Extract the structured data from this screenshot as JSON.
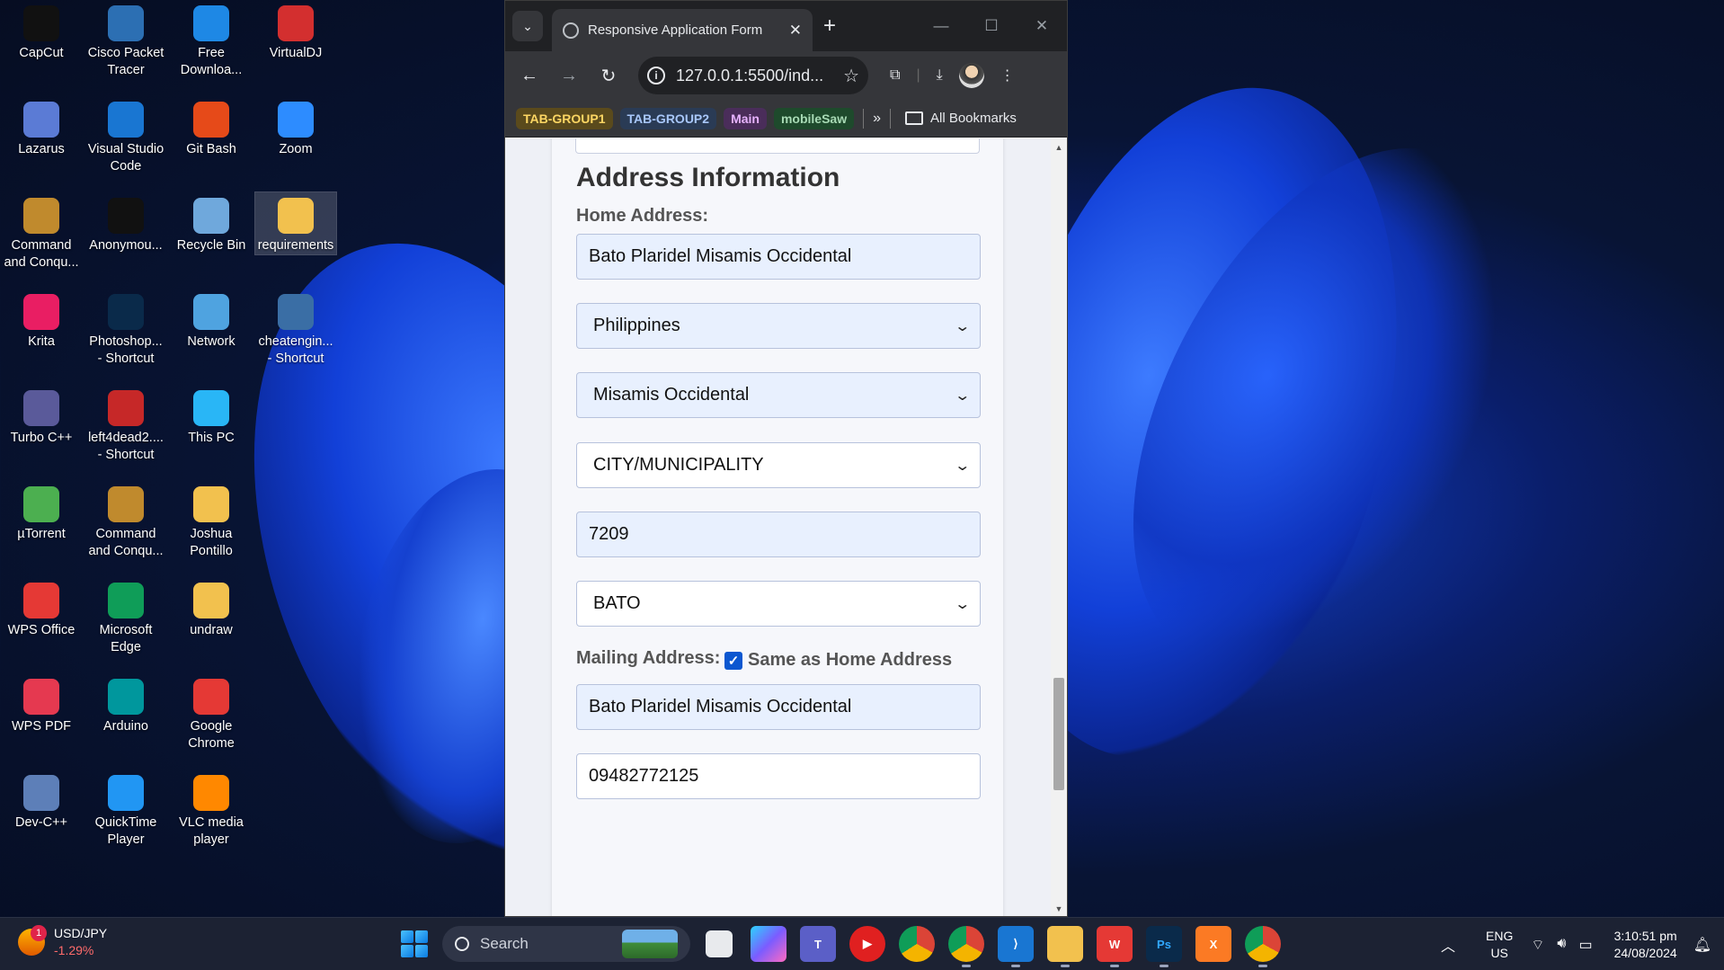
{
  "desktop": {
    "icons": [
      {
        "label": "CapCut",
        "icon": "capcut-icon",
        "color": "#111111"
      },
      {
        "label": "Cisco Packet Tracer",
        "icon": "packet-tracer-icon",
        "color": "#2c6fb3"
      },
      {
        "label": "Free Downloa...",
        "icon": "free-download-icon",
        "color": "#1e88e5"
      },
      {
        "label": "VirtualDJ",
        "icon": "virtualdj-icon",
        "color": "#d32f2f"
      },
      {
        "label": "Lazarus",
        "icon": "lazarus-icon",
        "color": "#5b7bd5"
      },
      {
        "label": "Visual Studio Code",
        "icon": "vscode-icon",
        "color": "#1976d2"
      },
      {
        "label": "Git Bash",
        "icon": "git-bash-icon",
        "color": "#e64a19"
      },
      {
        "label": "Zoom",
        "icon": "zoom-icon",
        "color": "#2d8cff"
      },
      {
        "label": "Command and Conqu...",
        "icon": "command-conquer-icon",
        "color": "#c08a2d"
      },
      {
        "label": "Anonymou...",
        "icon": "anonymous-icon",
        "color": "#111111"
      },
      {
        "label": "Recycle Bin",
        "icon": "recycle-bin-icon",
        "color": "#6fa8dc"
      },
      {
        "label": "requirements",
        "icon": "folder-icon",
        "color": "#f2c14e"
      },
      {
        "label": "Krita",
        "icon": "krita-icon",
        "color": "#e91e63"
      },
      {
        "label": "Photoshop... - Shortcut",
        "icon": "photoshop-icon",
        "color": "#0a2a4a"
      },
      {
        "label": "Network",
        "icon": "network-icon",
        "color": "#4fa3e0"
      },
      {
        "label": "cheatengin... - Shortcut",
        "icon": "cheat-engine-icon",
        "color": "#3a6ea5"
      },
      {
        "label": "Turbo C++",
        "icon": "turbo-cpp-icon",
        "color": "#5a5a9a"
      },
      {
        "label": "left4dead2.... - Shortcut",
        "icon": "left4dead-icon",
        "color": "#c62828"
      },
      {
        "label": "This PC",
        "icon": "this-pc-icon",
        "color": "#29b6f6"
      },
      {
        "label": "",
        "icon": "blank",
        "color": ""
      },
      {
        "label": "µTorrent",
        "icon": "utorrent-icon",
        "color": "#4caf50"
      },
      {
        "label": "Command and Conqu...",
        "icon": "command-conquer-icon",
        "color": "#c08a2d"
      },
      {
        "label": "Joshua Pontillo",
        "icon": "folder-icon",
        "color": "#f2c14e"
      },
      {
        "label": "",
        "icon": "blank",
        "color": ""
      },
      {
        "label": "WPS Office",
        "icon": "wps-office-icon",
        "color": "#e53935"
      },
      {
        "label": "Microsoft Edge",
        "icon": "edge-icon",
        "color": "#0f9d58"
      },
      {
        "label": "undraw",
        "icon": "folder-icon",
        "color": "#f2c14e"
      },
      {
        "label": "",
        "icon": "blank",
        "color": ""
      },
      {
        "label": "WPS PDF",
        "icon": "wps-pdf-icon",
        "color": "#e53950"
      },
      {
        "label": "Arduino",
        "icon": "arduino-icon",
        "color": "#00979d"
      },
      {
        "label": "Google Chrome",
        "icon": "chrome-icon",
        "color": "#e53935"
      },
      {
        "label": "",
        "icon": "blank",
        "color": ""
      },
      {
        "label": "Dev-C++",
        "icon": "devcpp-icon",
        "color": "#5d7fb8"
      },
      {
        "label": "QuickTime Player",
        "icon": "quicktime-icon",
        "color": "#2196f3"
      },
      {
        "label": "VLC media player",
        "icon": "vlc-icon",
        "color": "#ff8800"
      }
    ]
  },
  "browser": {
    "tab_title": "Responsive Application Form",
    "url": "127.0.0.1:5500/ind...",
    "bookmarks": [
      {
        "label": "TAB-GROUP1",
        "bg": "#5a4a1c",
        "fg": "#fdd663"
      },
      {
        "label": "TAB-GROUP2",
        "bg": "#2a3b55",
        "fg": "#a8c7fa"
      },
      {
        "label": "Main",
        "bg": "#4a2d5a",
        "fg": "#e7b3ff"
      },
      {
        "label": "mobileSaw",
        "bg": "#1e4a2c",
        "fg": "#a8dab5"
      }
    ],
    "all_bookmarks": "All Bookmarks"
  },
  "form": {
    "section_title": "Address Information",
    "home_address_label": "Home Address:",
    "home_address": "Bato Plaridel Misamis Occidental",
    "country": "Philippines",
    "province": "Misamis Occidental",
    "city": "CITY/MUNICIPALITY",
    "zip": "7209",
    "barangay": "BATO",
    "mailing_label": "Mailing Address:",
    "same_as_home": "Same as Home Address",
    "mailing_address": "Bato Plaridel Misamis Occidental",
    "phone_partial": "09482772125"
  },
  "taskbar": {
    "widget_title": "USD/JPY",
    "widget_change": "-1.29%",
    "widget_badge": "1",
    "search_placeholder": "Search",
    "lang_top": "ENG",
    "lang_bottom": "US",
    "time": "3:10:51 pm",
    "date": "24/08/2024"
  }
}
